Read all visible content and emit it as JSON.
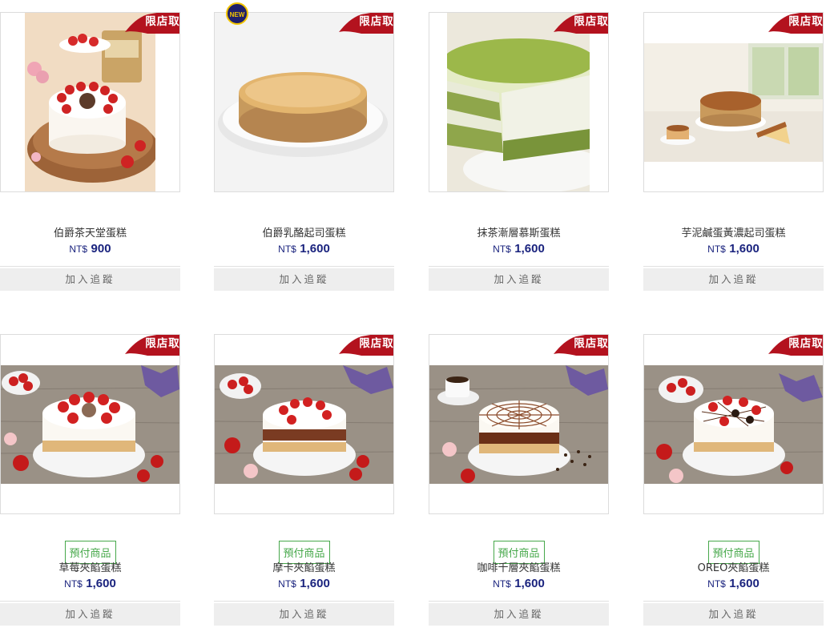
{
  "colors": {
    "price": "#1a237e",
    "tag": "#b3121e",
    "prepay": "#46a84a",
    "new_badge": "#1f1f6b"
  },
  "products": [
    {
      "name": "伯爵茶天堂蛋糕",
      "currency": "NT$",
      "price": "900",
      "tag": "限店取",
      "button": "加入追蹤",
      "photo": "earl-grey-strawberry-cake-icon"
    },
    {
      "name": "伯爵乳酪起司蛋糕",
      "currency": "NT$",
      "price": "1,600",
      "tag": "限店取",
      "badge": "NEW",
      "button": "加入追蹤",
      "photo": "cheesecake-icon"
    },
    {
      "name": "抹茶漸層慕斯蛋糕",
      "currency": "NT$",
      "price": "1,600",
      "tag": "限店取",
      "button": "加入追蹤",
      "photo": "matcha-mousse-icon"
    },
    {
      "name": "芋泥鹹蛋黃濃起司蛋糕",
      "currency": "NT$",
      "price": "1,600",
      "tag": "限店取",
      "button": "加入追蹤",
      "photo": "taro-cheesecake-icon"
    },
    {
      "name": "草莓夾餡蛋糕",
      "currency": "NT$",
      "price": "1,600",
      "tag": "限店取",
      "prepay": "預付商品",
      "button": "加入追蹤",
      "photo": "strawberry-cake-icon"
    },
    {
      "name": "摩卡夾餡蛋糕",
      "currency": "NT$",
      "price": "1,600",
      "tag": "限店取",
      "prepay": "預付商品",
      "button": "加入追蹤",
      "photo": "mocha-cake-icon"
    },
    {
      "name": "咖啡千層夾餡蛋糕",
      "currency": "NT$",
      "price": "1,600",
      "tag": "限店取",
      "prepay": "預付商品",
      "button": "加入追蹤",
      "photo": "coffee-cake-icon"
    },
    {
      "name": "OREO夾餡蛋糕",
      "currency": "NT$",
      "price": "1,600",
      "tag": "限店取",
      "prepay": "預付商品",
      "button": "加入追蹤",
      "photo": "oreo-cake-icon"
    }
  ]
}
